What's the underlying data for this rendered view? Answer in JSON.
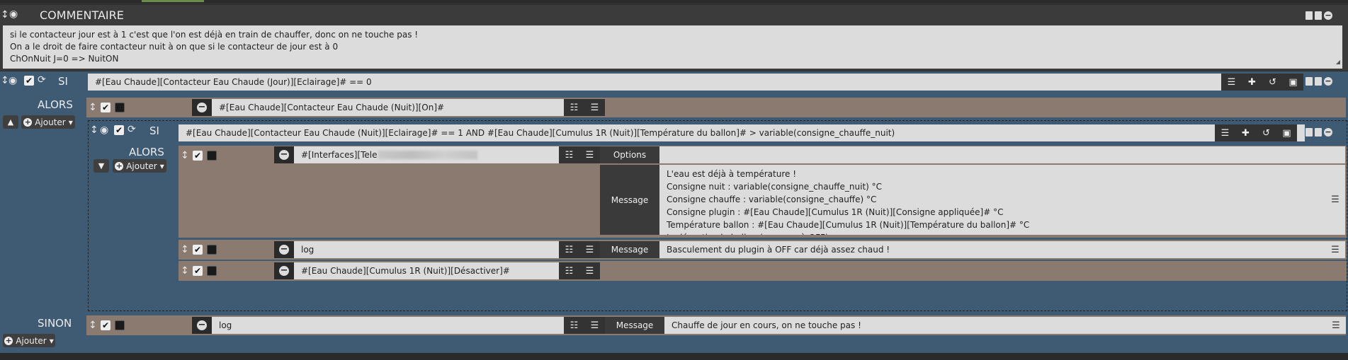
{
  "comment": {
    "title": "COMMENTAIRE",
    "lines": [
      "si le contacteur jour est à 1 c'est que l'on est déjà en train de chauffer, donc on ne touche pas !",
      "On a le droit de faire contacteur nuit à on que si le contacteur de jour est à 0",
      "ChOnNuit J=0 => NuitON"
    ]
  },
  "si1": {
    "label": "SI",
    "condition": "#[Eau Chaude][Contacteur Eau Chaude (Jour)][Eclairage]# == 0"
  },
  "alors1": {
    "label": "ALORS",
    "add_label": "Ajouter",
    "action": "#[Eau Chaude][Contacteur Eau Chaude (Nuit)][On]#"
  },
  "si2": {
    "label": "SI",
    "condition": "#[Eau Chaude][Contacteur Eau Chaude (Nuit)][Eclairage]# == 1 AND #[Eau Chaude][Cumulus 1R (Nuit)][Température du ballon]# > variable(consigne_chauffe_nuit)"
  },
  "alors2": {
    "label": "ALORS",
    "add_label": "Ajouter",
    "actions": [
      {
        "command": "#[Interfaces][Tele",
        "tag": "Options",
        "message_label": "Message",
        "message": "L'eau est déjà à température !\nConsigne nuit : variable(consigne_chauffe_nuit) °C\nConsigne chauffe : variable(consigne_chauffe) °C\nConsigne plugin : #[Eau Chaude][Cumulus 1R (Nuit)][Consigne appliquée]# °C\nTempérature ballon : #[Eau Chaude][Cumulus 1R (Nuit)][Température du ballon]# °C\nJe désactive le ballon (passage à OFF)"
      },
      {
        "command": "log",
        "tag": "Message",
        "message": "Basculement du plugin à OFF car déjà assez chaud !"
      },
      {
        "command": "#[Eau Chaude][Cumulus 1R (Nuit)][Désactiver]#"
      }
    ]
  },
  "sinon": {
    "label": "SINON",
    "add_label": "Ajouter",
    "action": {
      "command": "log",
      "tag": "Message",
      "message": "Chauffe de jour en cours, on ne touche pas !"
    }
  },
  "icons": {
    "move": "↕",
    "eye": "👁",
    "check": "✔",
    "refresh": "⟳",
    "list": "☷",
    "plugin": "✚",
    "history": "↺",
    "cube": "■"
  },
  "colors": {
    "block_blue": "#3e5b73",
    "nested_brown": "#8b7a70",
    "field_grey": "#dcdcdc"
  }
}
